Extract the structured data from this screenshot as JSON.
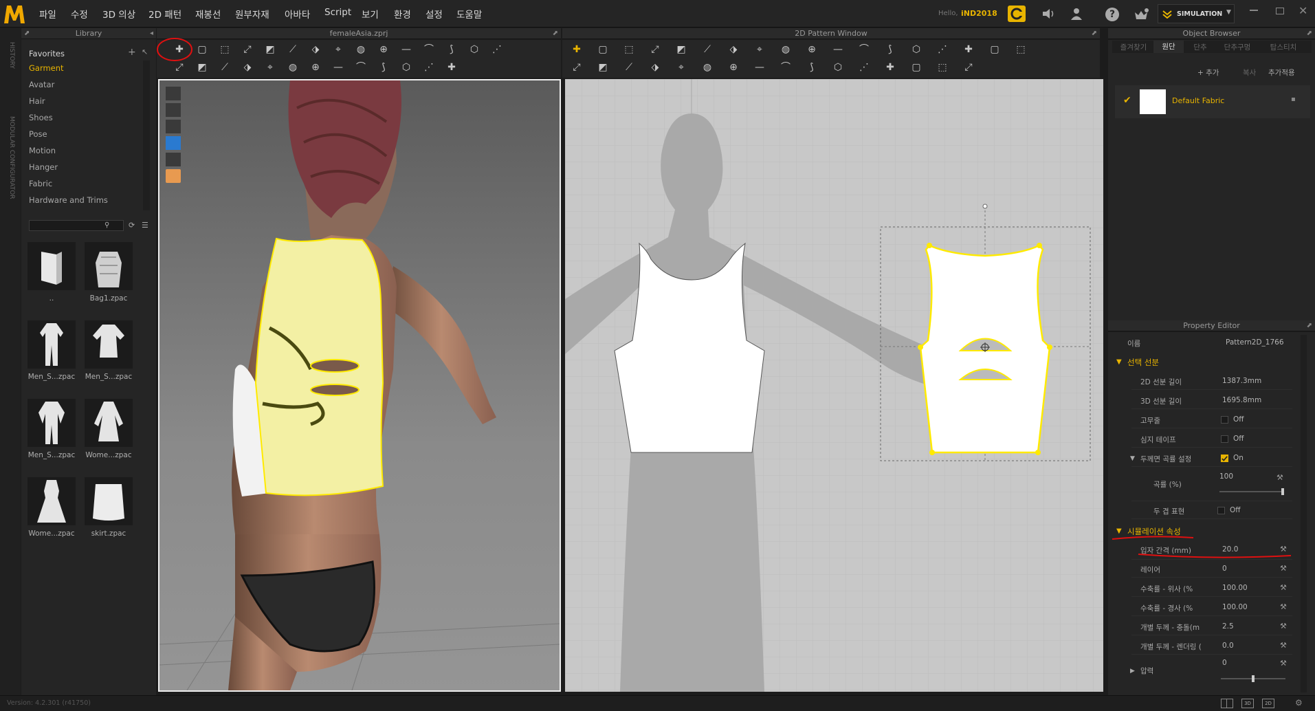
{
  "menubar": {
    "items": [
      "파일",
      "수정",
      "3D 의상",
      "2D 패턴",
      "재봉선",
      "원부자재",
      "아바타",
      "Script",
      "보기",
      "환경",
      "설정",
      "도움말"
    ],
    "greeting": "Hello,",
    "username": "iND2018",
    "mode": "SIMULATION"
  },
  "sidebar": {
    "history": "HISTORY",
    "modular": "MODULAR CONFIGURATOR"
  },
  "library": {
    "title": "Library",
    "favorites": "Favorites",
    "items": [
      "Garment",
      "Avatar",
      "Hair",
      "Shoes",
      "Pose",
      "Motion",
      "Hanger",
      "Fabric",
      "Hardware and Trims"
    ],
    "search_placeholder": "",
    "tiles": [
      {
        "label": ".."
      },
      {
        "label": "Bag1.zpac"
      },
      {
        "label": "Men_S...zpac"
      },
      {
        "label": "Men_S...zpac"
      },
      {
        "label": "Men_S...zpac"
      },
      {
        "label": "Wome...zpac"
      },
      {
        "label": "Wome...zpac"
      },
      {
        "label": "skirt.zpac"
      }
    ]
  },
  "view3d": {
    "title": "femaleAsia.zprj"
  },
  "view2d": {
    "title": "2D Pattern Window"
  },
  "object_browser": {
    "title": "Object Browser",
    "tabs": [
      "즐겨찾기",
      "원단",
      "단추",
      "단추구멍",
      "탑스티치"
    ],
    "active_tab": "원단",
    "add": "+ 추가",
    "copy": "복사",
    "add_apply": "추가적용",
    "fabric": "Default Fabric"
  },
  "property_editor": {
    "title": "Property Editor",
    "name_label": "이름",
    "name_value": "Pattern2D_1766",
    "section_selection": "선택 선분",
    "rows_selection": [
      {
        "label": "2D 선분 길이",
        "value": "1387.3mm"
      },
      {
        "label": "3D 선분 길이",
        "value": "1695.8mm"
      },
      {
        "label": "고무줄",
        "value": "Off"
      },
      {
        "label": "심지 테이프",
        "value": "Off"
      },
      {
        "label": "두께면 곡률 설정",
        "value": "On"
      },
      {
        "label": "곡률 (%)",
        "value": "100"
      },
      {
        "label": "두 겹 표현",
        "value": "Off"
      }
    ],
    "section_sim": "시뮬레이션 속성",
    "rows_sim": [
      {
        "label": "입자 간격 (mm)",
        "value": "20.0"
      },
      {
        "label": "레이어",
        "value": "0"
      },
      {
        "label": "수축률 - 위사 (%",
        "value": "100.00"
      },
      {
        "label": "수축률 - 경사 (%",
        "value": "100.00"
      },
      {
        "label": "개별 두께 - 충돌(m",
        "value": "2.5"
      },
      {
        "label": "개별 두께 - 렌더링 (",
        "value": "0.0"
      }
    ],
    "pressure_label": "압력",
    "pressure_value": "0"
  },
  "statusbar": {
    "version": "Version: 4.2.301 (r41750)"
  },
  "colors": {
    "accent": "#e8b400",
    "garment": "#f3f0a4",
    "highlight": "#ffea00",
    "annotation": "#e01010"
  }
}
